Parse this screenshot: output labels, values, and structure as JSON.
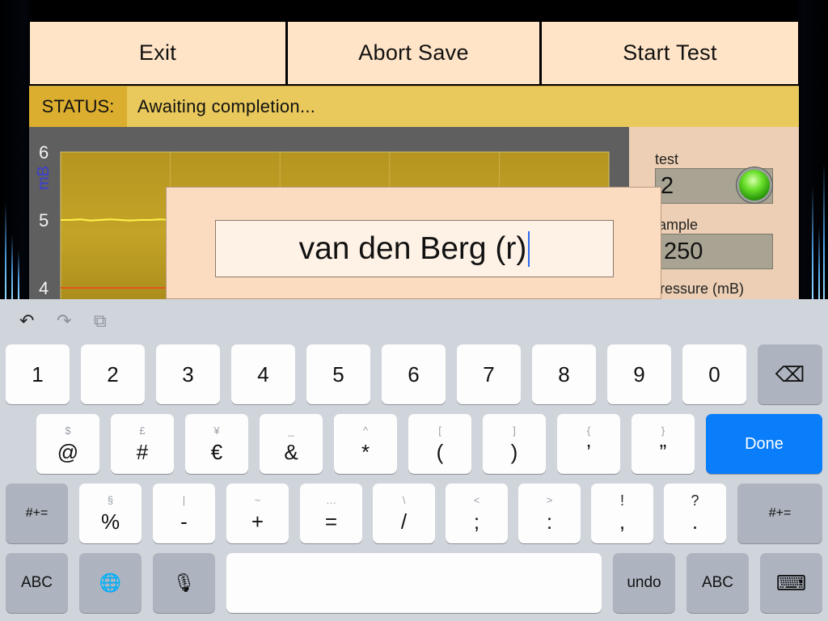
{
  "toolbar": {
    "exit_label": "Exit",
    "abort_label": "Abort Save",
    "start_label": "Start Test"
  },
  "status": {
    "label": "STATUS:",
    "text": "Awaiting completion..."
  },
  "chart_data": {
    "type": "line",
    "ylabel": "mB",
    "yticks": [
      "6",
      "5",
      "4"
    ],
    "series": [
      {
        "values": [
          5.0,
          5.0,
          5.01,
          4.99,
          5.0,
          5.01,
          5.0,
          4.99,
          5.0,
          5.0,
          5.01,
          5.0
        ],
        "color": "#fff24a"
      }
    ],
    "reference_lines": [
      {
        "value": 4.0,
        "color": "#e2571f"
      }
    ],
    "colors": {
      "background": "#b99a22",
      "grid": "#d8c46a"
    }
  },
  "side": {
    "test_label": "test",
    "test_value": "2",
    "sample_label": "ample",
    "sample_value": "250",
    "pressure_label": "ressure (mB)",
    "led_color": "#5fd923"
  },
  "modal": {
    "input_value": "van den Berg (r)"
  },
  "keyboard": {
    "tools": {
      "undo_icon": "↶",
      "redo_icon": "↷",
      "paste_icon": "⧉"
    },
    "row1": [
      "1",
      "2",
      "3",
      "4",
      "5",
      "6",
      "7",
      "8",
      "9",
      "0"
    ],
    "backspace_icon": "⌫",
    "row2": [
      {
        "main": "@",
        "alt": "$"
      },
      {
        "main": "#",
        "alt": "£"
      },
      {
        "main": "€",
        "alt": "¥"
      },
      {
        "main": "&",
        "alt": "_"
      },
      {
        "main": "*",
        "alt": "^"
      },
      {
        "main": "(",
        "alt": "["
      },
      {
        "main": ")",
        "alt": "]"
      },
      {
        "main": "’",
        "alt": "{"
      },
      {
        "main": "”",
        "alt": "}"
      }
    ],
    "done_label": "Done",
    "row3_left": "#+=",
    "row3": [
      {
        "main": "%",
        "alt": "§"
      },
      {
        "main": "-",
        "alt": "|"
      },
      {
        "main": "+",
        "alt": "~"
      },
      {
        "main": "=",
        "alt": "…"
      },
      {
        "main": "/",
        "alt": "\\"
      },
      {
        "main": ";",
        "alt": "<"
      },
      {
        "main": ":",
        "alt": ">"
      },
      {
        "main": ",",
        "alt": "!"
      },
      {
        "main": ".",
        "alt": "?"
      }
    ],
    "row3_right": "#+=",
    "abc_left": "ABC",
    "globe_icon": "🌐",
    "mic_icon": "🎙",
    "space_label": "",
    "undo_label": "undo",
    "abc_right": "ABC",
    "hide_icon": "⌨"
  }
}
